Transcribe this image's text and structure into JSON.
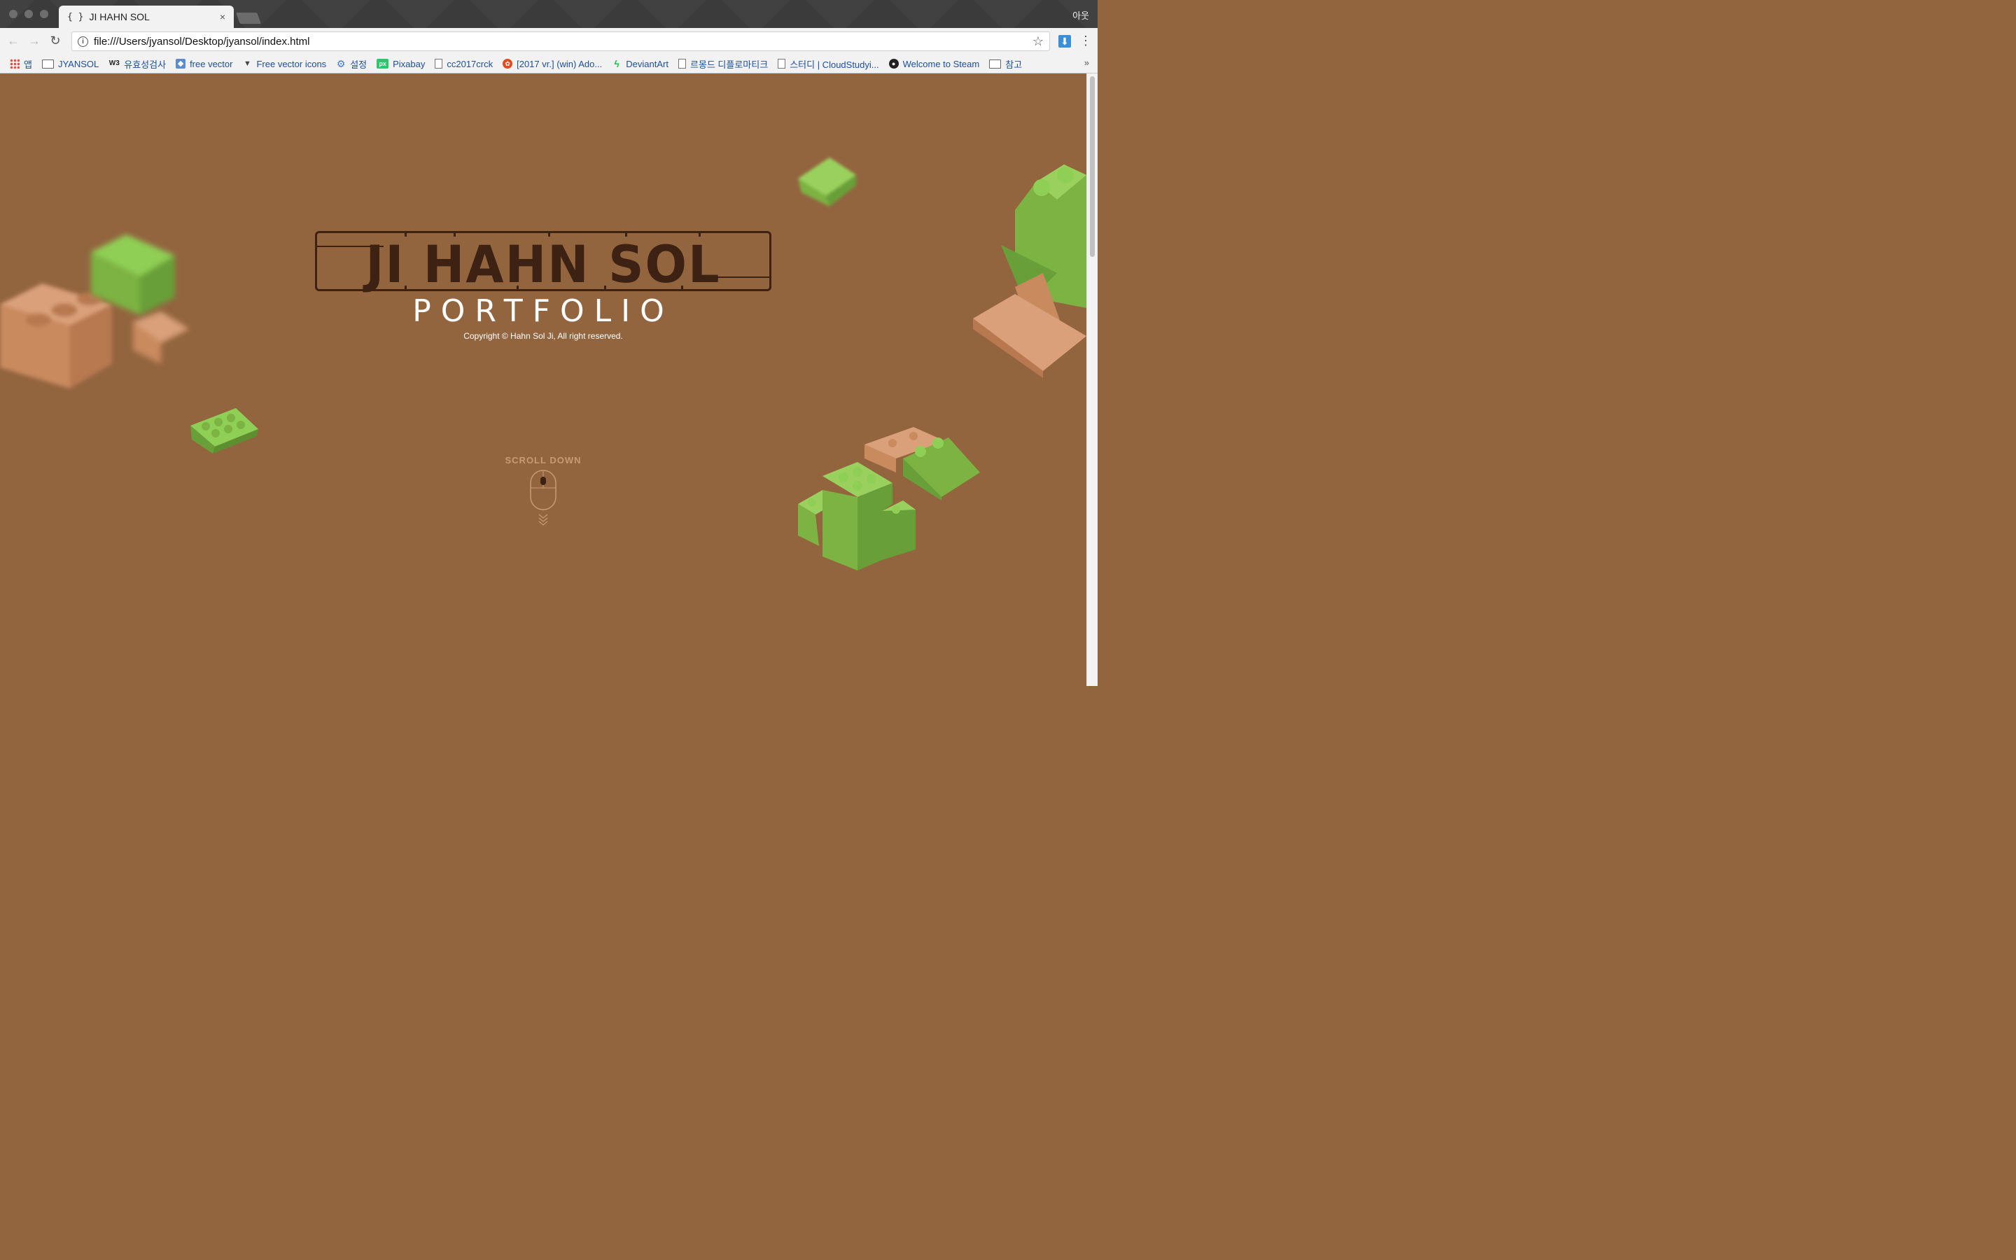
{
  "browser": {
    "tab_title": "JI HAHN SOL",
    "tab_favicon": "{ }",
    "tab_close": "×",
    "profile": "아웃",
    "url": "file:///Users/jyansol/Desktop/jyansol/index.html",
    "star": "☆",
    "back": "←",
    "forward": "→",
    "reload": "↻",
    "menu": "⋮",
    "download": "⬇"
  },
  "bookmarks": {
    "items": [
      {
        "label": "앱",
        "icon": "apps-icon"
      },
      {
        "label": "JYANSOL",
        "icon": "folder-icon"
      },
      {
        "label": "유효성검사",
        "icon": "w3c-icon"
      },
      {
        "label": "free vector",
        "icon": "vector-icon"
      },
      {
        "label": "Free vector icons",
        "icon": "flaticon-icon"
      },
      {
        "label": "설정",
        "icon": "gear-icon"
      },
      {
        "label": "Pixabay",
        "icon": "pixabay-icon"
      },
      {
        "label": "cc2017crck",
        "icon": "page-icon"
      },
      {
        "label": "[2017 vr.] (win) Ado...",
        "icon": "red-circle-icon"
      },
      {
        "label": "DeviantArt",
        "icon": "deviantart-icon"
      },
      {
        "label": "르몽드 디플로마티크",
        "icon": "page-icon"
      },
      {
        "label": "스터디 | CloudStudyi...",
        "icon": "page-icon"
      },
      {
        "label": "Welcome to Steam",
        "icon": "steam-icon"
      },
      {
        "label": "참고",
        "icon": "folder-icon"
      }
    ],
    "more": "»"
  },
  "page": {
    "logo": "JI HAHN SOL",
    "subtitle": "PORTFOLIO",
    "copyright": "Copyright © Hahn Sol Ji, All right reserved.",
    "scroll_label": "SCROLL DOWN"
  },
  "colors": {
    "background": "#93653f",
    "logo": "#3d2112",
    "lego_green": "#7cb342",
    "lego_tan": "#c98a5e",
    "scroll_text": "#c99a72"
  }
}
